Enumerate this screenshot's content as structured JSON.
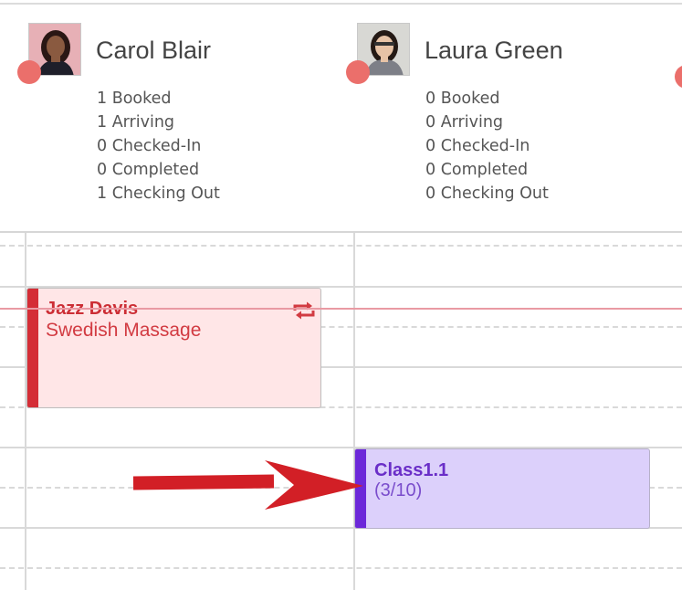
{
  "staff": [
    {
      "name": "Carol Blair",
      "status_color": "#eb6f6b",
      "stats": [
        "1 Booked",
        "1 Arriving",
        "0 Checked-In",
        "0 Completed",
        "1 Checking Out"
      ]
    },
    {
      "name": "Laura Green",
      "status_color": "#eb6f6b",
      "stats": [
        "0 Booked",
        "0 Arriving",
        "0 Checked-In",
        "0 Completed",
        "0 Checking Out"
      ]
    }
  ],
  "appointments": {
    "massage": {
      "client": "Jazz Davis",
      "service": "Swedish Massage",
      "icon": "recurring-icon",
      "color": "#d42d36"
    },
    "class": {
      "name": "Class1.1",
      "capacity": "(3/10)",
      "color": "#6c28d9"
    }
  },
  "annotation": {
    "icon": "red-arrow-icon",
    "color": "#d21f26"
  }
}
